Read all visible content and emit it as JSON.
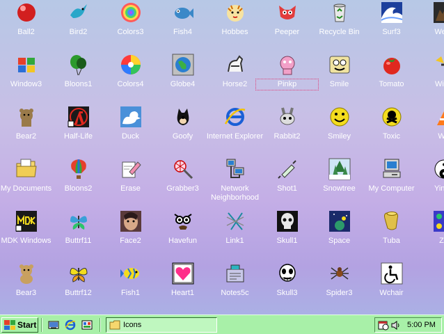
{
  "desktop": {
    "icons": [
      {
        "label": "Ball2",
        "icon": "ball-icon"
      },
      {
        "label": "Bird2",
        "icon": "bird-icon"
      },
      {
        "label": "Colors3",
        "icon": "colors-icon"
      },
      {
        "label": "Fish4",
        "icon": "fish-icon"
      },
      {
        "label": "Hobbes",
        "icon": "tiger-icon"
      },
      {
        "label": "Peeper",
        "icon": "peeper-icon"
      },
      {
        "label": "Recycle Bin",
        "icon": "recycle-bin-icon"
      },
      {
        "label": "Surf3",
        "icon": "wave-icon"
      },
      {
        "label": "Were",
        "icon": "werewolf-icon"
      },
      {
        "label": "Window3",
        "icon": "windows-flag-icon"
      },
      {
        "label": "Bloons1",
        "icon": "balloons-icon"
      },
      {
        "label": "Colors4",
        "icon": "color-wheel-icon"
      },
      {
        "label": "Globe4",
        "icon": "globe-icon"
      },
      {
        "label": "Horse2",
        "icon": "horse-icon"
      },
      {
        "label": "Pinkp",
        "icon": "pink-panther-icon"
      },
      {
        "label": "Smile",
        "icon": "smile-icon"
      },
      {
        "label": "Tomato",
        "icon": "tomato-icon"
      },
      {
        "label": "Winp",
        "icon": "winp-icon"
      },
      {
        "label": "Bear2",
        "icon": "bear-icon"
      },
      {
        "label": "Half-Life",
        "icon": "half-life-icon"
      },
      {
        "label": "Duck",
        "icon": "duck-icon"
      },
      {
        "label": "Goofy",
        "icon": "goofy-icon"
      },
      {
        "label": "Internet Explorer",
        "icon": "internet-explorer-icon"
      },
      {
        "label": "Rabbit2",
        "icon": "rabbit-icon"
      },
      {
        "label": "Smiley",
        "icon": "smiley-icon"
      },
      {
        "label": "Toxic",
        "icon": "toxic-skull-icon"
      },
      {
        "label": "Wo",
        "icon": "cone-icon"
      },
      {
        "label": "My Documents",
        "icon": "folder-icon"
      },
      {
        "label": "Bloons2",
        "icon": "hot-air-balloon-icon"
      },
      {
        "label": "Erase",
        "icon": "eraser-icon"
      },
      {
        "label": "Grabber3",
        "icon": "net-icon"
      },
      {
        "label": "Network Neighborhood",
        "icon": "network-icon"
      },
      {
        "label": "Shot1",
        "icon": "syringe-icon"
      },
      {
        "label": "Snowtree",
        "icon": "snow-tree-icon"
      },
      {
        "label": "My Computer",
        "icon": "computer-icon"
      },
      {
        "label": "Yingy",
        "icon": "yin-yang-icon"
      },
      {
        "label": "MDK Windows",
        "icon": "mdk-icon"
      },
      {
        "label": "Buttrf11",
        "icon": "butterfly-icon"
      },
      {
        "label": "Face2",
        "icon": "face-icon"
      },
      {
        "label": "Havefun",
        "icon": "glasses-icon"
      },
      {
        "label": "Link1",
        "icon": "link-icon"
      },
      {
        "label": "Skull1",
        "icon": "skull-icon"
      },
      {
        "label": "Space",
        "icon": "space-icon"
      },
      {
        "label": "Tuba",
        "icon": "tuba-icon"
      },
      {
        "label": "Ze",
        "icon": "pattern-icon"
      },
      {
        "label": "Bear3",
        "icon": "teddy-bear-icon"
      },
      {
        "label": "Buttrf12",
        "icon": "butterfly-yellow-icon"
      },
      {
        "label": "Fish1",
        "icon": "fish-blue-icon"
      },
      {
        "label": "Heart1",
        "icon": "heart-icon"
      },
      {
        "label": "Notes5c",
        "icon": "notes-icon"
      },
      {
        "label": "Skull3",
        "icon": "skeleton-icon"
      },
      {
        "label": "Spider3",
        "icon": "spider-icon"
      },
      {
        "label": "Wchair",
        "icon": "wheelchair-icon"
      }
    ],
    "selected_label": "Pinkp"
  },
  "taskbar": {
    "start_label": "Start",
    "quick_launch": [
      "desktop-icon",
      "internet-explorer-icon",
      "channels-icon"
    ],
    "task_button_label": "Icons",
    "clock": "5:00 PM",
    "colors": {
      "bar": "#a8f0a8"
    }
  }
}
